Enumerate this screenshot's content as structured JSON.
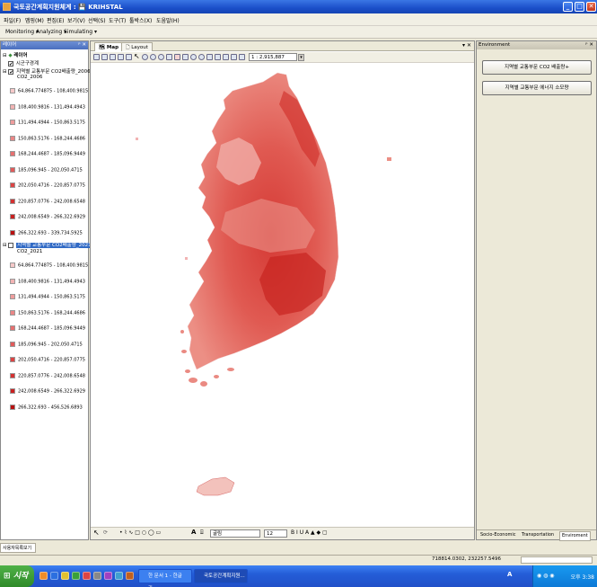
{
  "window": {
    "title": "국토공간계획지원체계 : 💾 KRIHSTAL",
    "controls": [
      "_",
      "□",
      "✕"
    ]
  },
  "menu": {
    "items": [
      "파일(F)",
      "맵핑(M)",
      "편집(E)",
      "보기(V)",
      "선택(S)",
      "도구(T)",
      "툴박스(X)",
      "도움말(H)"
    ]
  },
  "toolbar": {
    "items": [
      "Monitoring ▾",
      "Analyzing ▾",
      "Simulating ▾"
    ]
  },
  "layers": {
    "panel_title": "레이어",
    "root": "레이어",
    "groups": [
      {
        "name": "시군구경계",
        "checked": true
      },
      {
        "name": "지역별 교통부문 CO2배출량_2006",
        "field": "CO2_2006",
        "checked": true,
        "selected": false,
        "legend": [
          {
            "label": "64,864.774875 - 108,400.9815",
            "color": "#f6c9c9"
          },
          {
            "label": "108,400.9816 - 131,494.4943",
            "color": "#f2b3b3"
          },
          {
            "label": "131,494.4944 - 150,863.5175",
            "color": "#ee9c9c"
          },
          {
            "label": "150,863.5176 - 168,244.4686",
            "color": "#ea8686"
          },
          {
            "label": "168,244.4687 - 185,096.9449",
            "color": "#e67070"
          },
          {
            "label": "185,096.945 - 202,050.4715",
            "color": "#e15a5a"
          },
          {
            "label": "202,050.4716 - 220,857.0775",
            "color": "#dc4444"
          },
          {
            "label": "220,857.0776 - 242,008.6548",
            "color": "#d43131"
          },
          {
            "label": "242,008.6549 - 266,322.6929",
            "color": "#c92020"
          },
          {
            "label": "266,322.693 - 339,734.5925",
            "color": "#b81010"
          }
        ]
      },
      {
        "name": "지역별 교통부문 CO2배출량_2021",
        "field": "CO2_2021",
        "checked": false,
        "selected": true,
        "legend": [
          {
            "label": "64,864.774875 - 108,400.9815",
            "color": "#f6c9c9"
          },
          {
            "label": "108,400.9816 - 131,494.4943",
            "color": "#f2b3b3"
          },
          {
            "label": "131,494.4944 - 150,863.5175",
            "color": "#ee9c9c"
          },
          {
            "label": "150,863.5176 - 168,244.4686",
            "color": "#ea8686"
          },
          {
            "label": "168,244.4687 - 185,096.9449",
            "color": "#e67070"
          },
          {
            "label": "185,096.945 - 202,050.4715",
            "color": "#e15a5a"
          },
          {
            "label": "202,050.4716 - 220,857.0775",
            "color": "#dc4444"
          },
          {
            "label": "220,857.0776 - 242,008.6548",
            "color": "#d43131"
          },
          {
            "label": "242,008.6549 - 266,322.6929",
            "color": "#c92020"
          },
          {
            "label": "266,322.693 - 456,526.6893",
            "color": "#b81010"
          }
        ]
      }
    ]
  },
  "map": {
    "tabs": [
      "Map",
      "Layout"
    ],
    "active_tab": "Map",
    "scale": "1 : 2,915,887",
    "draw_font": "굴림",
    "draw_size": "12"
  },
  "environment": {
    "panel_title": "Environment",
    "buttons": [
      "지역별 교통부문 CO2 배출량+",
      "지역별 교통부문 에너지 소모량"
    ],
    "tabs": [
      "Socio-Economic",
      "Transportation",
      "Enviroment"
    ],
    "active_tab": "Enviroment"
  },
  "bottom": {
    "tab": "사용자목록보기"
  },
  "status": {
    "coords": "718814.0302, 232257.5496"
  },
  "taskbar": {
    "start": "시작",
    "tasks": [
      "한 문서 1 - 한글과...",
      "국토공간계획지원..."
    ],
    "lang": "A",
    "clock": "오후 3:38"
  }
}
